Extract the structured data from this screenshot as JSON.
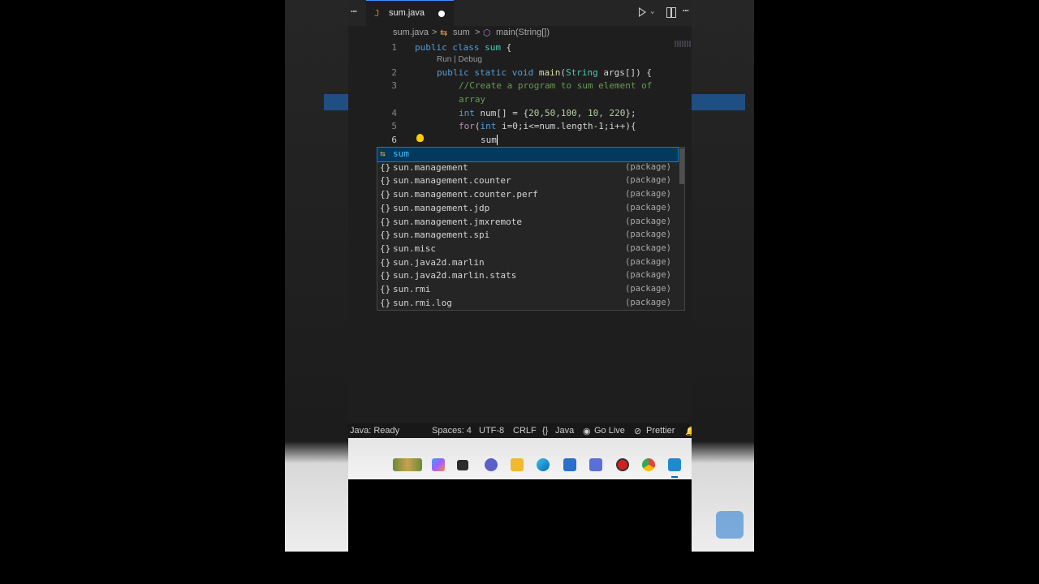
{
  "editor": {
    "tab": {
      "icon": "java-file-icon",
      "filename": "sum.java",
      "dirty_dot": "●",
      "more": "⋯"
    },
    "actions": {
      "run": "run-icon",
      "dropdown": "⌄",
      "split": "split-editor-icon",
      "more": "⋯"
    },
    "breadcrumb": {
      "file": "sum.java",
      "sep1": ">",
      "class_icon": "⇆",
      "class": "sum",
      "sep2": ">",
      "method_icon": "⬡",
      "method": "main(String[])"
    },
    "codelens": "Run | Debug",
    "lines": [
      {
        "num": "1"
      },
      {
        "num": "2"
      },
      {
        "num": "3"
      },
      {
        "num": ""
      },
      {
        "num": "4"
      },
      {
        "num": "5"
      },
      {
        "num": "6"
      }
    ],
    "code": {
      "l1_kw": "public class ",
      "l1_name": "sum",
      "l1_rest": " {",
      "l2_kw": "public static void ",
      "l2_fn": "main",
      "l2_p1": "(",
      "l2_type": "String",
      "l2_arg": " args[]) {",
      "l3_comment": "//Create a program to sum element of",
      "l3b_comment": "array",
      "l4_kw": "int",
      "l4_rest": " num[] = {",
      "l4_nums": "20,50,100, 10, 220",
      "l4_end": "};",
      "l5_kw": "for",
      "l5_p": "(",
      "l5_kw2": "int",
      "l5_rest": " i=0;i<=num.length-1;i++){",
      "l6_typed": "sum"
    }
  },
  "suggestions": [
    {
      "icon": "⇆",
      "label": "sum",
      "detail": ""
    },
    {
      "icon": "{}",
      "label": "sun.management",
      "detail": "(package)"
    },
    {
      "icon": "{}",
      "label": "sun.management.counter",
      "detail": "(package)"
    },
    {
      "icon": "{}",
      "label": "sun.management.counter.perf",
      "detail": "(package)"
    },
    {
      "icon": "{}",
      "label": "sun.management.jdp",
      "detail": "(package)"
    },
    {
      "icon": "{}",
      "label": "sun.management.jmxremote",
      "detail": "(package)"
    },
    {
      "icon": "{}",
      "label": "sun.management.spi",
      "detail": "(package)"
    },
    {
      "icon": "{}",
      "label": "sun.misc",
      "detail": "(package)"
    },
    {
      "icon": "{}",
      "label": "sun.java2d.marlin",
      "detail": "(package)"
    },
    {
      "icon": "{}",
      "label": "sun.java2d.marlin.stats",
      "detail": "(package)"
    },
    {
      "icon": "{}",
      "label": "sun.rmi",
      "detail": "(package)"
    },
    {
      "icon": "{}",
      "label": "sun.rmi.log",
      "detail": "(package)"
    }
  ],
  "statusbar": {
    "java": "Java: Ready",
    "spaces": "Spaces: 4",
    "encoding": "UTF-8",
    "eol": "CRLF",
    "lang_icon": "{}",
    "language": "Java",
    "golive_icon": "broadcast-icon",
    "golive": "Go Live",
    "prettier_icon": "prohibited-icon",
    "prettier": "Prettier"
  },
  "taskbar": {
    "icons": [
      "widgets-icon",
      "copilot-icon",
      "terminal-icon",
      "teams-icon",
      "file-explorer-icon",
      "edge-icon",
      "store-icon",
      "visual-studio-icon",
      "record-icon",
      "chrome-icon",
      "vscode-icon"
    ]
  },
  "colors": {
    "accent": "#007fd4",
    "selection": "#04395e",
    "editor_bg": "#1e1e1e",
    "keyword": "#569cd6",
    "comment": "#6a9955"
  }
}
